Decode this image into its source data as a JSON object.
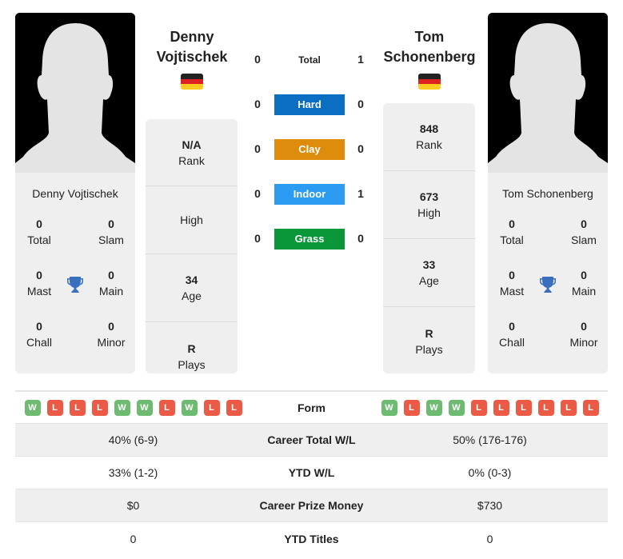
{
  "players": [
    {
      "name": "Denny Vojtischek",
      "name_line1": "Denny",
      "name_line2": "Vojtischek",
      "country": "Germany",
      "flag_colors": [
        "#222222",
        "#dd2222",
        "#ffcc22"
      ],
      "titles": {
        "total": {
          "value": "0",
          "label": "Total"
        },
        "slam": {
          "value": "0",
          "label": "Slam"
        },
        "mast": {
          "value": "0",
          "label": "Mast"
        },
        "main": {
          "value": "0",
          "label": "Main"
        },
        "chall": {
          "value": "0",
          "label": "Chall"
        },
        "minor": {
          "value": "0",
          "label": "Minor"
        }
      },
      "stats": [
        {
          "value": "N/A",
          "label": "Rank"
        },
        {
          "value": "",
          "label": "High"
        },
        {
          "value": "34",
          "label": "Age"
        },
        {
          "value": "R",
          "label": "Plays"
        }
      ],
      "form": [
        "W",
        "L",
        "L",
        "L",
        "W",
        "W",
        "L",
        "W",
        "L",
        "L"
      ]
    },
    {
      "name": "Tom Schonenberg",
      "name_line1": "Tom",
      "name_line2": "Schonenberg",
      "country": "Germany",
      "flag_colors": [
        "#222222",
        "#dd2222",
        "#ffcc22"
      ],
      "titles": {
        "total": {
          "value": "0",
          "label": "Total"
        },
        "slam": {
          "value": "0",
          "label": "Slam"
        },
        "mast": {
          "value": "0",
          "label": "Mast"
        },
        "main": {
          "value": "0",
          "label": "Main"
        },
        "chall": {
          "value": "0",
          "label": "Chall"
        },
        "minor": {
          "value": "0",
          "label": "Minor"
        }
      },
      "stats": [
        {
          "value": "848",
          "label": "Rank"
        },
        {
          "value": "673",
          "label": "High"
        },
        {
          "value": "33",
          "label": "Age"
        },
        {
          "value": "R",
          "label": "Plays"
        }
      ],
      "form": [
        "W",
        "L",
        "W",
        "W",
        "L",
        "L",
        "L",
        "L",
        "L",
        "L"
      ]
    }
  ],
  "h2h": [
    {
      "label": "Total",
      "left": "0",
      "right": "1",
      "color": ""
    },
    {
      "label": "Hard",
      "left": "0",
      "right": "0",
      "color": "#0a6fc2"
    },
    {
      "label": "Clay",
      "left": "0",
      "right": "0",
      "color": "#dd8c0c"
    },
    {
      "label": "Indoor",
      "left": "0",
      "right": "1",
      "color": "#2b9cf2"
    },
    {
      "label": "Grass",
      "left": "0",
      "right": "0",
      "color": "#0a973a"
    }
  ],
  "comparison": {
    "form_label": "Form",
    "rows": [
      {
        "label": "Career Total W/L",
        "left": "40% (6-9)",
        "right": "50% (176-176)"
      },
      {
        "label": "YTD W/L",
        "left": "33% (1-2)",
        "right": "0% (0-3)"
      },
      {
        "label": "Career Prize Money",
        "left": "$0",
        "right": "$730"
      },
      {
        "label": "YTD Titles",
        "left": "0",
        "right": "0"
      }
    ]
  },
  "colors": {
    "win": "#6dbb70",
    "loss": "#ea5a44",
    "trophy": "#3a6fc0",
    "card_bg": "#efefef"
  }
}
